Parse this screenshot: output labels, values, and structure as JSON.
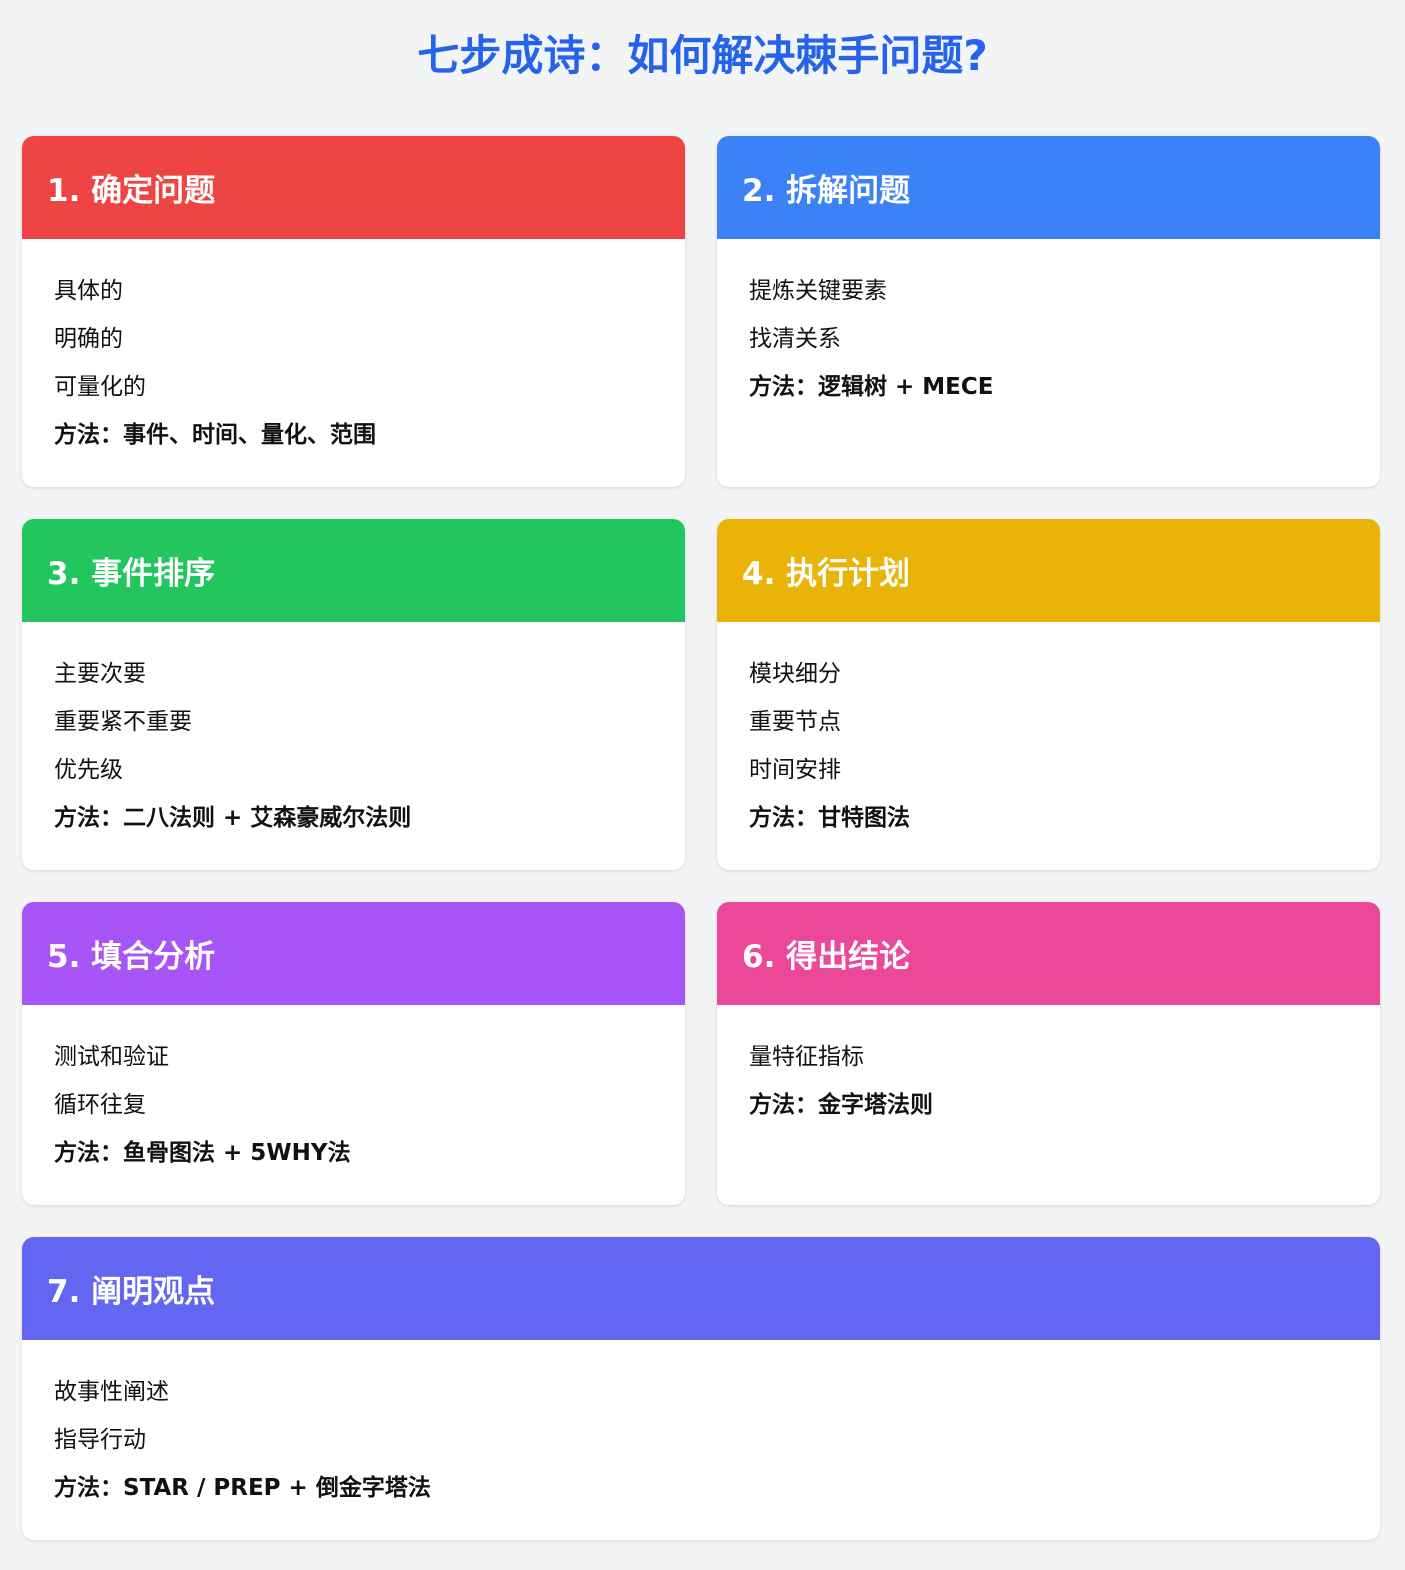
{
  "title": "七步成诗：如何解决棘手问题?",
  "cards": [
    {
      "heading": "1. 确定问题",
      "color": "#ef4444",
      "items": [
        "具体的",
        "明确的",
        "可量化的"
      ],
      "method": "方法：事件、时间、量化、范围"
    },
    {
      "heading": "2. 拆解问题",
      "color": "#3b82f6",
      "items": [
        "提炼关键要素",
        "找清关系"
      ],
      "method": "方法：逻辑树 + MECE"
    },
    {
      "heading": "3. 事件排序",
      "color": "#22c55e",
      "items": [
        "主要次要",
        "重要紧不重要",
        "优先级"
      ],
      "method": "方法：二八法则 + 艾森豪威尔法则"
    },
    {
      "heading": "4. 执行计划",
      "color": "#eab308",
      "items": [
        "模块细分",
        "重要节点",
        "时间安排"
      ],
      "method": "方法：甘特图法"
    },
    {
      "heading": "5. 填合分析",
      "color": "#a855f7",
      "items": [
        "测试和验证",
        "循环往复"
      ],
      "method": "方法：鱼骨图法 + 5WHY法"
    },
    {
      "heading": "6. 得出结论",
      "color": "#ec4899",
      "items": [
        "量特征指标"
      ],
      "method": "方法：金字塔法则"
    },
    {
      "heading": "7. 阐明观点",
      "color": "#6366f1",
      "items": [
        "故事性阐述",
        "指导行动"
      ],
      "method": "方法：STAR / PREP + 倒金字塔法"
    }
  ]
}
